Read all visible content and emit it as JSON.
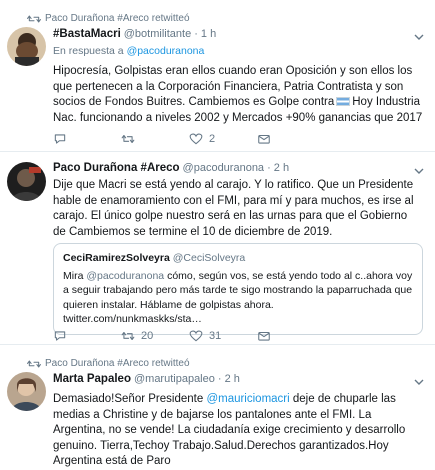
{
  "tweets": [
    {
      "retweet_context": "Paco Durañona #Areco retwitteó",
      "name": "#BastaMacri",
      "handle": "@botmilitante",
      "time": "· 1 h",
      "reply_prefix": "En respuesta a",
      "reply_handle": "@pacoduranona",
      "text_part1": "Hipocresía, Golpistas eran ellos cuando eran Oposición y son ellos los que pertenecen a la Corporación Financiera, Patria Contratista y son socios de Fondos Buitres. Cambiemos es Golpe contra",
      "text_part2": "Hoy Industria Nac. funcionando a niveles 2002 y Mercados +90% ganancias que 2017",
      "reply_count": "",
      "retweet_count": "",
      "like_count": "2"
    },
    {
      "name": "Paco Durañona #Areco",
      "handle": "@pacoduranona",
      "time": "· 2 h",
      "text": "Dije que Macri se está yendo al carajo. Y lo ratifico. Que un Presidente hable de enamoramiento con el FMI, para mí y para muchos, es irse al carajo. El único golpe nuestro será en las urnas para que el Gobierno de Cambiemos se termine el 10 de diciembre de 2019.",
      "quote": {
        "name": "CeciRamirezSolveyra",
        "handle": "@CeciSolveyra",
        "text_prefix": "Mira",
        "text_mention": "@pacoduranona",
        "text_rest": "cómo, según vos, se está yendo todo al c..ahora voy a seguir trabajando pero más tarde te sigo mostrando la paparruchada que quieren instalar. Háblame de golpistas ahora. twitter.com/nunkmaskks/sta…"
      },
      "reply_count": "",
      "retweet_count": "20",
      "like_count": "31"
    },
    {
      "retweet_context": "Paco Durañona #Areco retwitteó",
      "name": "Marta Papaleo",
      "handle": "@marutipapaleo",
      "time": "· 2 h",
      "text_part1": "Demasiado!Señor Presidente",
      "mention": "@mauriciomacri",
      "text_part2": "deje de chuparle las medias a Christine y de bajarse los pantalones ante el FMI. La Argentina, no se vende! La ciudadanía exige crecimiento y desarrollo genuino. Tierra,Techoy Trabajo.Salud.Derechos garantizados.Hoy Argentina está de Paro"
    }
  ],
  "colors": {
    "link": "#1b95e0",
    "muted": "#657786",
    "text": "#14171a",
    "divider": "#e6ecf0"
  }
}
